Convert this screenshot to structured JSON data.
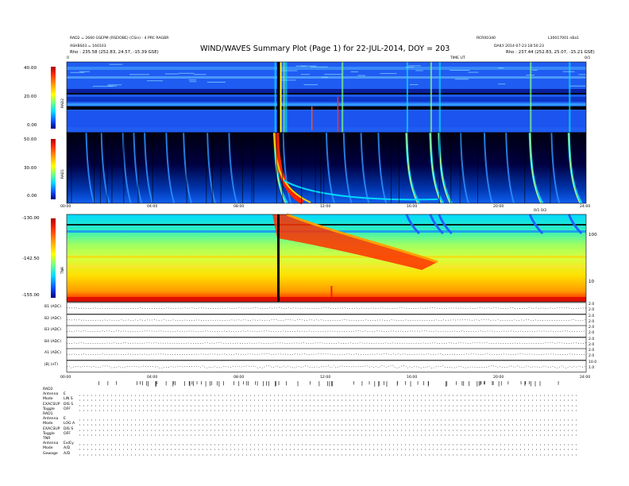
{
  "header": {
    "title": "WIND/WAVES Summary Plot (Page 1) for 22-JUL-2014, DOY = 203",
    "left_line1": "RAD2 = 2660 GSEPM (RSEIOBE) (CSin) - 4 PRC RAGBR",
    "left_line2": "ASHBS03 = 160103",
    "left_line3": "Rho : 235.58 (252.83, 24.57, -15.39 GSE)",
    "right_line1": "RCR003d0",
    "right_line2": "L30017001 nBa1",
    "right_line3": "DAILY 2014-07-23 18:50:23",
    "right_line4": "Rho : 237.44 (252.83, 25.07, -15.21 GSE)",
    "time_label": "TIME UT",
    "top_left_corner": "0",
    "top_right_corner": "0/1"
  },
  "panels": {
    "rad2": {
      "label": "RAD2",
      "ticks": [
        "40.00",
        "20.00",
        "0.00"
      ]
    },
    "rad1": {
      "label": "RAD1",
      "ticks": [
        "50.00",
        "30.00",
        "0.00"
      ]
    },
    "tnr": {
      "label": "TNR",
      "ticks": [
        "-130.00",
        "-142.50",
        "-155.00"
      ],
      "right_ticks": [
        "100",
        "10"
      ],
      "right_top": "0/1 0/2"
    },
    "time_axis_ticks": [
      "00:00",
      "04:00",
      "08:00",
      "12:00",
      "16:00",
      "20:00",
      "24:00"
    ],
    "time_axis_ticks_small": [
      "00:00",
      "04:00",
      "08:00",
      "12:00",
      "16:00",
      "20:00",
      "24:00"
    ]
  },
  "bx_panels": [
    {
      "label": "B1 (ADC)",
      "rticks": [
        "2.0",
        "2.0"
      ]
    },
    {
      "label": "B2 (ADC)",
      "rticks": [
        "2.0",
        "2.0"
      ]
    },
    {
      "label": "B3 (ADC)",
      "rticks": [
        "2.0",
        "2.0"
      ]
    },
    {
      "label": "B4 (ADC)",
      "rticks": [
        "2.0",
        "2.0"
      ]
    },
    {
      "label": "A1 (ADC)",
      "rticks": [
        "2.0",
        "2.0"
      ]
    },
    {
      "label": "|B| (nT)",
      "rticks": [
        "10.0",
        "1.0"
      ]
    }
  ],
  "settings": {
    "rad2": {
      "head": "RAD2",
      "rows": [
        [
          "Antenna",
          "E"
        ],
        [
          "Mode",
          "LIN S"
        ],
        [
          "EXACSUP",
          "DIS S"
        ],
        [
          "Toggle",
          "OFF"
        ]
      ]
    },
    "rad1": {
      "head": "RAD1",
      "rows": [
        [
          "Antenna",
          "E"
        ],
        [
          "Mode",
          "LOG A"
        ],
        [
          "EXACSUP",
          "DIS S"
        ],
        [
          "Toggle",
          "OFF"
        ]
      ]
    },
    "tnr": {
      "head": "TNR",
      "rows": [
        [
          "Antenna",
          "Ex/Ey"
        ],
        [
          "Mode",
          "A/D"
        ],
        [
          "Gewage",
          "A/D"
        ]
      ]
    }
  },
  "chart_data": {
    "type": "heatmap",
    "title": "WIND/WAVES Summary Plot (Page 1) for 22-JUL-2014, DOY = 203",
    "x_range_hours": [
      0,
      24
    ],
    "x_ticks": [
      "00:00",
      "04:00",
      "08:00",
      "12:00",
      "16:00",
      "20:00",
      "24:00"
    ],
    "panels": [
      {
        "name": "RAD2",
        "ylim": [
          0,
          40
        ],
        "yticks": [
          40,
          20,
          0
        ]
      },
      {
        "name": "RAD1",
        "ylim": [
          0,
          50
        ],
        "yticks": [
          50,
          30,
          0
        ]
      },
      {
        "name": "TNR",
        "ylim": [
          -155,
          -130
        ],
        "yticks": [
          -130,
          -142.5,
          -155
        ],
        "right_axis": "log",
        "right_ticks": [
          100,
          10
        ]
      }
    ],
    "events_hours": [
      9.6,
      10.0,
      10.1,
      12.7,
      15.7,
      16.8,
      17.2,
      21.4,
      23.2
    ],
    "major_burst_hours": 9.8,
    "colorscale": [
      "#000080",
      "#0050ff",
      "#00e0ff",
      "#7cff7c",
      "#ffff00",
      "#ffa500",
      "#ff2800",
      "#b00000"
    ]
  }
}
